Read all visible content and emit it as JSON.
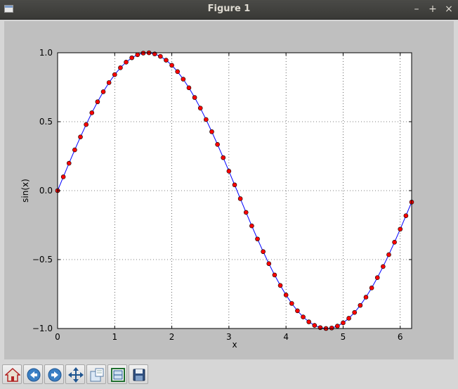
{
  "window": {
    "title": "Figure 1",
    "minimize_glyph": "–",
    "maximize_glyph": "+",
    "close_glyph": "×"
  },
  "toolbar": {
    "tools": [
      {
        "name": "home",
        "icon": "home-icon"
      },
      {
        "name": "back",
        "icon": "back-arrow-icon"
      },
      {
        "name": "forward",
        "icon": "forward-arrow-icon"
      },
      {
        "name": "pan",
        "icon": "move-arrows-icon"
      },
      {
        "name": "zoom",
        "icon": "zoom-rect-icon"
      },
      {
        "name": "subplots",
        "icon": "subplots-icon"
      },
      {
        "name": "save",
        "icon": "save-disk-icon"
      }
    ]
  },
  "chart_data": {
    "type": "line",
    "xlabel": "x",
    "ylabel": "sin(x)",
    "xlim": [
      0,
      6.2
    ],
    "ylim": [
      -1.0,
      1.0
    ],
    "xticks": [
      0,
      1,
      2,
      3,
      4,
      5,
      6
    ],
    "xtick_labels": [
      "0",
      "1",
      "2",
      "3",
      "4",
      "5",
      "6"
    ],
    "yticks": [
      1.0,
      0.5,
      0.0,
      -0.5,
      -1.0
    ],
    "ytick_labels": [
      "1.0",
      "0.5",
      "0.0",
      "−0.5",
      "−1.0"
    ],
    "grid": true,
    "series": [
      {
        "function": "sin(x)",
        "x_start": 0,
        "x_step": 0.1,
        "count": 63,
        "line_color": "#0000ff",
        "marker": "circle",
        "marker_color": "#ff0000",
        "marker_edge": "#000000"
      }
    ]
  }
}
